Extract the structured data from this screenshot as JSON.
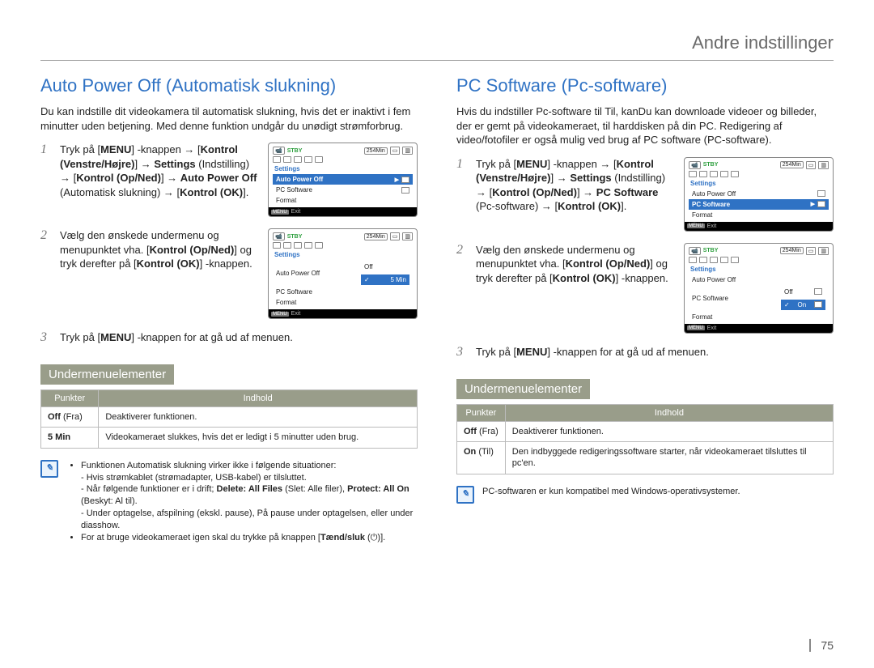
{
  "page_header": "Andre indstillinger",
  "page_number": "75",
  "left": {
    "title": "Auto Power Off (Automatisk slukning)",
    "intro": "Du kan indstille dit videokamera til automatisk slukning, hvis det er inaktivt i fem minutter uden betjening. Med denne funktion undgår du unødigt strømforbrug.",
    "step1": {
      "num": "1",
      "t1": "Tryk på [",
      "b1": "MENU",
      "t2": "] ‑knappen → [",
      "b2": "Kontrol (Venstre/Højre)",
      "t3": "] → ",
      "b3": "Settings",
      "t4": " (Indstilling) → [",
      "b4": "Kontrol (Op/Ned)",
      "t5": "] → ",
      "b5": "Auto Power Off",
      "t6": " (Automatisk slukning) → [",
      "b6": "Kontrol (OK)",
      "t7": "]."
    },
    "step2": {
      "num": "2",
      "t1": "Vælg den ønskede undermenu og menupunktet vha. [",
      "b1": "Kontrol (Op/Ned)",
      "t2": "] og tryk derefter på [",
      "b2": "Kontrol (OK)",
      "t3": "] ‑knappen."
    },
    "step3": {
      "num": "3",
      "t1": "Tryk på [",
      "b1": "MENU",
      "t2": "] ‑knappen for at gå ud af menuen."
    },
    "screen1": {
      "stby": "STBY",
      "min": "254Min",
      "settings": "Settings",
      "items": [
        "Auto Power Off",
        "PC Software",
        "Format"
      ],
      "sel_index": 0,
      "footer_exit": "Exit",
      "footer_menu": "MENU"
    },
    "screen2": {
      "stby": "STBY",
      "min": "254Min",
      "settings": "Settings",
      "items": [
        "Auto Power Off",
        "PC Software",
        "Format"
      ],
      "opts": [
        "Off",
        "5 Min"
      ],
      "opt_sel_index": 1,
      "footer_exit": "Exit",
      "footer_menu": "MENU"
    },
    "submenu_heading": "Undermenuelementer",
    "table": {
      "h1": "Punkter",
      "h2": "Indhold",
      "r1c1a": "Off",
      "r1c1b": " (Fra)",
      "r1c2": "Deaktiverer funktionen.",
      "r2c1": "5 Min",
      "r2c2": "Videokameraet slukkes, hvis det er ledigt i 5 minutter uden brug."
    },
    "note": {
      "bul1": "Funktionen Automatisk slukning virker ikke i følgende situationer:",
      "sub1": "Hvis strømkablet (strømadapter, USB-kabel) er tilsluttet.",
      "sub2a": "Når følgende funktioner er i drift; ",
      "sub2b": "Delete: All Files",
      "sub2c": " (Slet: Alle filer), ",
      "sub2d": "Protect: All On",
      "sub2e": " (Beskyt: Al til).",
      "sub3": "Under optagelse, afspilning (ekskl. pause), På pause under optagelsen, eller under diasshow.",
      "bul2a": "For at bruge videokameraet igen skal du trykke på knappen [",
      "bul2b": "Tænd/sluk",
      "bul2c": " (",
      "bul2d": ")]."
    }
  },
  "right": {
    "title": "PC Software (Pc-software)",
    "intro": "Hvis du indstiller Pc-software til Til, kanDu kan downloade videoer og billeder, der er gemt på videokameraet, til harddisken på din PC. Redigering af video/fotofiler er også mulig ved brug af PC software (PC-software).",
    "step1": {
      "num": "1",
      "t1": "Tryk på [",
      "b1": "MENU",
      "t2": "] ‑knappen → [",
      "b2": "Kontrol (Venstre/Højre)",
      "t3": "] → ",
      "b3": "Settings",
      "t4": " (Indstilling) → [",
      "b4": "Kontrol (Op/Ned)",
      "t5": "] → ",
      "b5": "PC Software",
      "t6": " (Pc-software) → [",
      "b6": "Kontrol (OK)",
      "t7": "]."
    },
    "step2": {
      "num": "2",
      "t1": "Vælg den ønskede undermenu og menupunktet vha. [",
      "b1": "Kontrol (Op/Ned)",
      "t2": "] og tryk derefter på [",
      "b2": "Kontrol (OK)",
      "t3": "] ‑knappen."
    },
    "step3": {
      "num": "3",
      "t1": "Tryk på [",
      "b1": "MENU",
      "t2": "] ‑knappen for at gå ud af menuen."
    },
    "screen1": {
      "stby": "STBY",
      "min": "254Min",
      "settings": "Settings",
      "items": [
        "Auto Power Off",
        "PC Software",
        "Format"
      ],
      "sel_index": 1,
      "footer_exit": "Exit",
      "footer_menu": "MENU"
    },
    "screen2": {
      "stby": "STBY",
      "min": "254Min",
      "settings": "Settings",
      "items": [
        "Auto Power Off",
        "PC Software",
        "Format"
      ],
      "opts": [
        "Off",
        "On"
      ],
      "opt_sel_index": 1,
      "footer_exit": "Exit",
      "footer_menu": "MENU"
    },
    "submenu_heading": "Undermenuelementer",
    "table": {
      "h1": "Punkter",
      "h2": "Indhold",
      "r1c1a": "Off",
      "r1c1b": " (Fra)",
      "r1c2": "Deaktiverer funktionen.",
      "r2c1a": "On",
      "r2c1b": " (Til)",
      "r2c2": "Den indbyggede redigeringssoftware starter, når videokameraet tilsluttes til pc'en."
    },
    "note_text": "PC-softwaren er kun kompatibel med Windows-operativsystemer."
  }
}
